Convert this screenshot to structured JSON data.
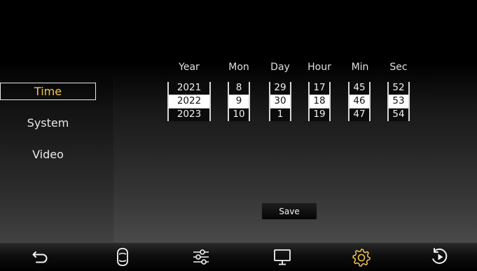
{
  "sidebar": {
    "items": [
      {
        "label": "Time",
        "active": true
      },
      {
        "label": "System",
        "active": false
      },
      {
        "label": "Video",
        "active": false
      }
    ]
  },
  "time_settings": {
    "columns": [
      {
        "header": "Year",
        "prev": "2021",
        "selected": "2022",
        "next": "2023"
      },
      {
        "header": "Mon",
        "prev": "8",
        "selected": "9",
        "next": "10"
      },
      {
        "header": "Day",
        "prev": "29",
        "selected": "30",
        "next": "1"
      },
      {
        "header": "Hour",
        "prev": "17",
        "selected": "18",
        "next": "19"
      },
      {
        "header": "Min",
        "prev": "45",
        "selected": "46",
        "next": "47"
      },
      {
        "header": "Sec",
        "prev": "52",
        "selected": "53",
        "next": "54"
      }
    ],
    "save_label": "Save"
  },
  "bottom_nav": {
    "items": [
      {
        "icon": "back-arrow-icon"
      },
      {
        "icon": "car-icon"
      },
      {
        "icon": "sliders-icon"
      },
      {
        "icon": "monitor-icon"
      },
      {
        "icon": "gear-icon",
        "active": true
      },
      {
        "icon": "replay-icon"
      }
    ]
  },
  "colors": {
    "accent": "#f3c44c",
    "text": "#e8e8e8",
    "selected_bg": "#ffffff"
  }
}
